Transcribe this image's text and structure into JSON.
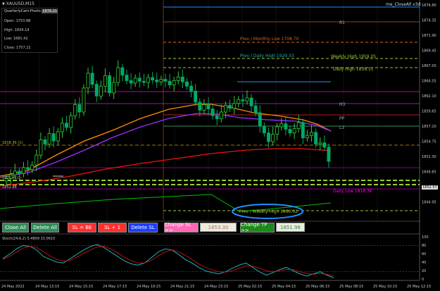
{
  "header": {
    "symbol_title": "XAUUSD,M15",
    "panel_title": "QuarterlyCam-Pivots",
    "panel_value": "1876.21",
    "indicator_name": "me_CloseAll v3d"
  },
  "ohlc": {
    "open": "Open: 1753.88",
    "high": "High: 1834.14",
    "low": "Low: 1681.42",
    "close": "Close: 1757.21"
  },
  "colors": {
    "background": "#000000",
    "grid": "#1e1e1e",
    "candle_up": "#32cd32",
    "candle_down": "#00aa66",
    "ma_fast": "#ff8c00",
    "ma_mid": "#9b30ff",
    "ma_slow": "#ee1111",
    "ma_slowest": "#00c000",
    "pivot_red": "#8b0000",
    "daily_high": "#1e90ff",
    "weekly_high": "#9acd32",
    "magenta": "#ff00ff",
    "ellipse": "#1e90ff"
  },
  "levels": {
    "r1": "R1",
    "h3": "H3",
    "pp": "PP",
    "l3": "L3",
    "prev_monthly_low": "Prev / Monthly Low 1708.70",
    "prev_daily_high": "Prev / Daily High 1929.33",
    "weekly_high": "Weekly High 1959.05",
    "daily_high": "Daily High 1838.51",
    "daily_low": "Daily Low 1818.36",
    "weekly_high_bottom": "Prev / Weekly High 1860.02",
    "left_tag_1": "1818.36 (1)",
    "left_tag_2": "1823.45(1)",
    "left_tag_3": "1852.86"
  },
  "buttons": {
    "close_all": "Close All",
    "delete_all": "Delete All",
    "sl_be": "SL = BE",
    "sl_plus1": "SL + 1",
    "delete_sl": "Delete SL",
    "change_sl": "Change SL >>",
    "sl_value": "1853.30",
    "change_tp": "Change TP >>",
    "tp_value": "1851.96"
  },
  "stoch": {
    "label": "Stoch(24,6,2) 5.4809 15.0610",
    "levels": [
      "80",
      "20"
    ]
  },
  "price_axis": {
    "labels": [
      "1876.80",
      "1874.35",
      "1871.90",
      "1869.45",
      "1867.00",
      "1864.55",
      "1862.10",
      "1859.65",
      "1857.20",
      "1854.75",
      "1852.30",
      "1849.85",
      "1847.40",
      "1844.95"
    ],
    "current_price": "1852.57",
    "stoch_labels": [
      "100",
      "80",
      "60",
      "40",
      "20",
      "0"
    ]
  },
  "time_axis": {
    "labels": [
      "24 May 2022",
      "24 May 13:15",
      "24 May 15:15",
      "24 May 17:15",
      "24 May 19:15",
      "24 May 21:15",
      "24 May 23:15",
      "25 May 02:15",
      "25 May 04:15",
      "25 May 06:15",
      "25 May 08:15",
      "25 May 10:15",
      "25 May 12:15"
    ]
  },
  "chart_data": {
    "type": "line",
    "title": "XAUUSD,M15",
    "y_range": [
      1843.5,
      1878.5
    ],
    "series": [
      {
        "name": "close",
        "values": [
          1850.2,
          1850.8,
          1851.4,
          1851.0,
          1852.0,
          1851.7,
          1852.4,
          1854.0,
          1856.5,
          1855.8,
          1857.5,
          1856.3,
          1857.8,
          1859.2,
          1858.5,
          1860.4,
          1862.2,
          1861.0,
          1864.9,
          1867.3,
          1865.5,
          1863.6,
          1865.2,
          1866.9,
          1864.1,
          1865.8,
          1868.2,
          1867.0,
          1866.1,
          1865.7,
          1866.5,
          1866.0,
          1865.8,
          1866.6,
          1866.2,
          1865.9,
          1866.3,
          1866.0,
          1865.4,
          1866.1,
          1866.7,
          1865.9,
          1865.2,
          1864.4,
          1862.6,
          1861.3,
          1862.2,
          1861.5,
          1860.4,
          1859.9,
          1861.0,
          1862.1,
          1861.6,
          1862.4,
          1863.0,
          1862.8,
          1863.3,
          1862.0,
          1860.9,
          1858.7,
          1857.6,
          1856.2,
          1857.4,
          1858.6,
          1859.1,
          1858.2,
          1857.6,
          1858.3,
          1859.3,
          1856.8,
          1857.2,
          1857.7,
          1855.8,
          1856.0,
          1855.3,
          1853.0
        ]
      }
    ]
  }
}
